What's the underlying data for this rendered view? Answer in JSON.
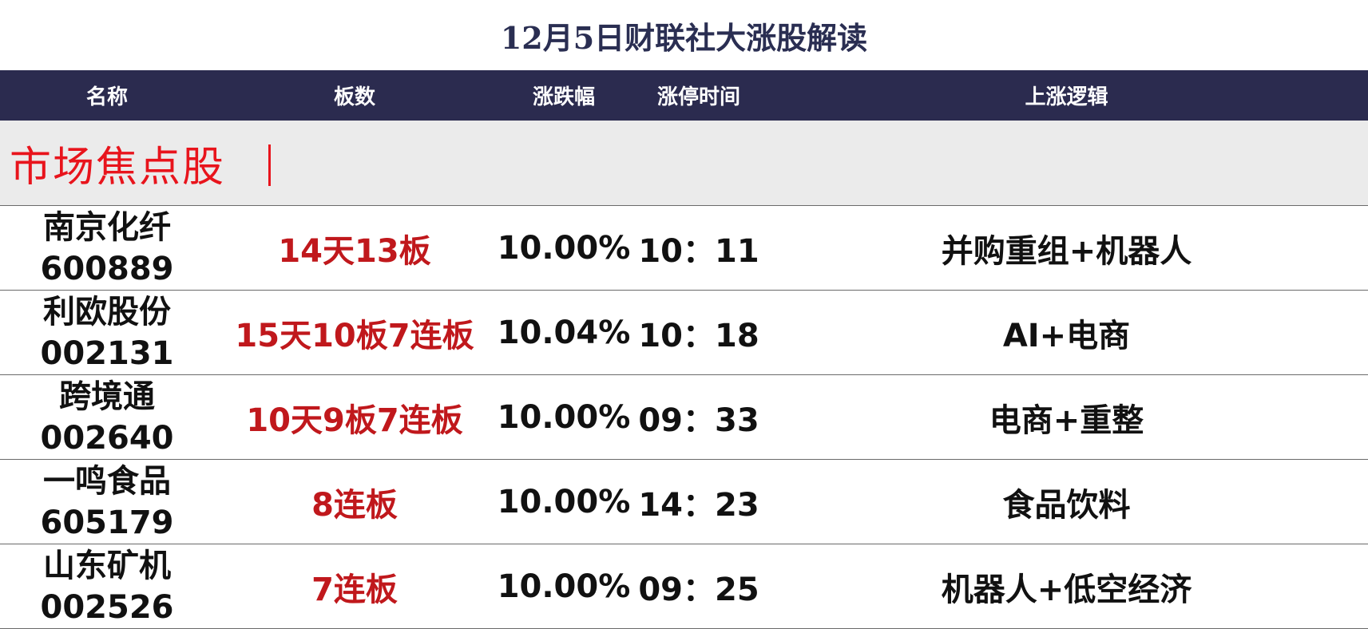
{
  "title": "12月5日财联社大涨股解读",
  "header": {
    "name": "名称",
    "boards": "板数",
    "change": "涨跌幅",
    "limit_time": "涨停时间",
    "reason": "上涨逻辑"
  },
  "section": {
    "label": "市场焦点股"
  },
  "rows": [
    {
      "name": "南京化纤",
      "code": "600889",
      "boards": "14天13板",
      "change": "10.00%",
      "time": "10：11",
      "reason": "并购重组+机器人"
    },
    {
      "name": "利欧股份",
      "code": "002131",
      "boards": "15天10板7连板",
      "change": "10.04%",
      "time": "10：18",
      "reason": "AI+电商"
    },
    {
      "name": "跨境通",
      "code": "002640",
      "boards": "10天9板7连板",
      "change": "10.00%",
      "time": "09：33",
      "reason": "电商+重整"
    },
    {
      "name": "一鸣食品",
      "code": "605179",
      "boards": "8连板",
      "change": "10.00%",
      "time": "14：23",
      "reason": "食品饮料"
    },
    {
      "name": "山东矿机",
      "code": "002526",
      "boards": "7连板",
      "change": "10.00%",
      "time": "09：25",
      "reason": "机器人+低空经济"
    }
  ],
  "colors": {
    "header_bg": "#2b2b4f",
    "title_text": "#2a2e52",
    "section_bg": "#ebebeb",
    "section_text": "#e8141c",
    "boards_text": "#c0181c"
  }
}
